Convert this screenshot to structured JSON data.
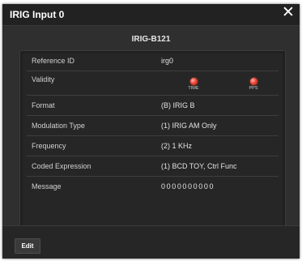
{
  "dialog": {
    "title": "IRIG Input 0",
    "close_glyph": "✕"
  },
  "subheader": "IRIG-B121",
  "rows": [
    {
      "label": "Reference ID",
      "value": "irg0"
    },
    {
      "label": "Validity",
      "indicators": [
        {
          "label": "TIME",
          "icon": "red-led-icon",
          "color": "#f04a3a"
        },
        {
          "label": "PPS",
          "icon": "red-led-icon",
          "color": "#f04a3a"
        }
      ]
    },
    {
      "label": "Format",
      "value": "(B) IRIG B"
    },
    {
      "label": "Modulation Type",
      "value": "(1) IRIG AM Only"
    },
    {
      "label": "Frequency",
      "value": "(2) 1 KHz"
    },
    {
      "label": "Coded Expression",
      "value": "(1) BCD TOY, Ctrl Func"
    },
    {
      "label": "Message",
      "value": "0000000000"
    }
  ],
  "footer": {
    "edit_label": "Edit"
  },
  "colors": {
    "background": "#2e2e2e",
    "panel": "#262626",
    "led_red": "#f04a3a"
  }
}
